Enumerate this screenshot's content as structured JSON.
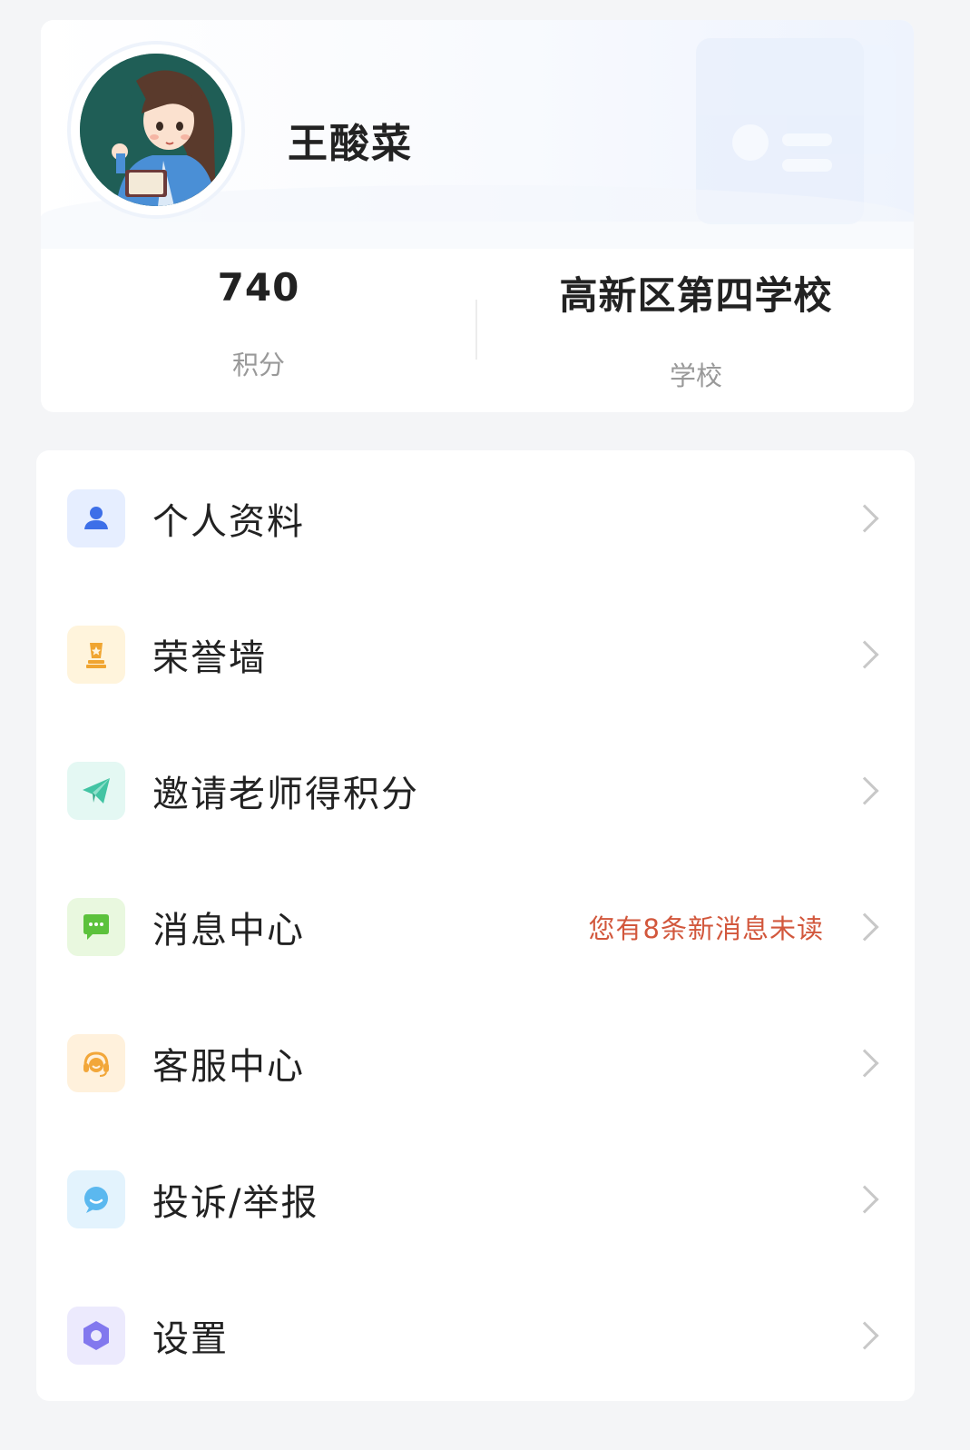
{
  "profile": {
    "name": "王酸菜",
    "points_value": "740",
    "points_label": "积分",
    "school_value": "高新区第四学校",
    "school_label": "学校"
  },
  "menu": {
    "items": [
      {
        "label": "个人资料",
        "icon": "user-icon",
        "icon_bg": "#e6eeff",
        "icon_color": "#3d6fe8"
      },
      {
        "label": "荣誉墙",
        "icon": "trophy-icon",
        "icon_bg": "#fff4dc",
        "icon_color": "#f0a531"
      },
      {
        "label": "邀请老师得积分",
        "icon": "paper-plane-icon",
        "icon_bg": "#e4f8f3",
        "icon_color": "#42c4a3"
      },
      {
        "label": "消息中心",
        "icon": "chat-bubble-icon",
        "icon_bg": "#e9f8df",
        "icon_color": "#5cc23c",
        "hint": "您有8条新消息未读"
      },
      {
        "label": "客服中心",
        "icon": "headset-icon",
        "icon_bg": "#fff1dc",
        "icon_color": "#f2a73a"
      },
      {
        "label": "投诉/举报",
        "icon": "smile-bubble-icon",
        "icon_bg": "#e3f3fd",
        "icon_color": "#5bb8ef"
      },
      {
        "label": "设置",
        "icon": "hexagon-settings-icon",
        "icon_bg": "#eceafd",
        "icon_color": "#8278ee"
      }
    ]
  },
  "colors": {
    "page_bg": "#f4f5f7",
    "hint": "#d2573c"
  }
}
